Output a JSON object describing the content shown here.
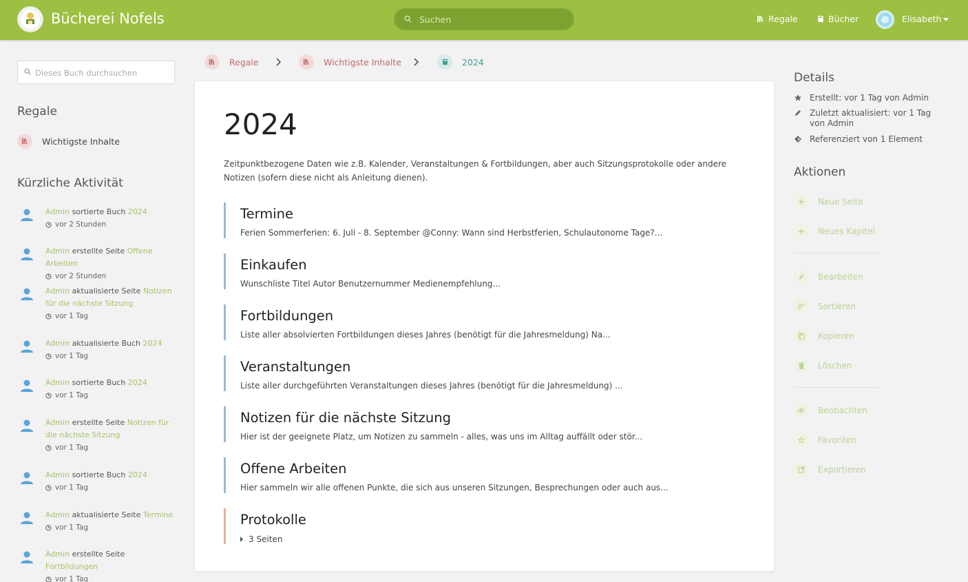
{
  "header": {
    "site_name": "Bücherei Nofels",
    "search_placeholder": "Suchen",
    "nav": [
      {
        "label": "Regale",
        "icon": "shelves-icon"
      },
      {
        "label": "Bücher",
        "icon": "book-icon"
      }
    ],
    "user": {
      "name": "Elisabeth"
    },
    "accent_color": "#9dbf42"
  },
  "left": {
    "book_search_placeholder": "Dieses Buch durchsuchen",
    "shelves_heading": "Regale",
    "shelf_item": "Wichtigste Inhalte",
    "activity_heading": "Kürzliche Aktivität",
    "activities": [
      {
        "user": "Admin",
        "action": "sortierte Buch",
        "target": "2024",
        "time": "vor 2 Stunden"
      },
      {
        "user": "Admin",
        "action": "erstellte Seite",
        "target": "Offene Arbeiten",
        "time": "vor 2 Stunden"
      },
      {
        "user": "Admin",
        "action": "aktualisierte Seite",
        "target": "Notizen für die nächste Sitzung",
        "time": "vor 1 Tag"
      },
      {
        "user": "Admin",
        "action": "aktualisierte Buch",
        "target": "2024",
        "time": "vor 1 Tag"
      },
      {
        "user": "Admin",
        "action": "sortierte Buch",
        "target": "2024",
        "time": "vor 1 Tag"
      },
      {
        "user": "Admin",
        "action": "erstellte Seite",
        "target": "Notizen für die nächste Sitzung",
        "time": "vor 1 Tag"
      },
      {
        "user": "Admin",
        "action": "sortierte Buch",
        "target": "2024",
        "time": "vor 1 Tag"
      },
      {
        "user": "Admin",
        "action": "aktualisierte Seite",
        "target": "Termine",
        "time": "vor 1 Tag"
      },
      {
        "user": "Admin",
        "action": "erstellte Seite",
        "target": "Fortbildungen",
        "time": "vor 1 Tag"
      }
    ]
  },
  "breadcrumb": [
    {
      "label": "Regale",
      "color": "#c06a6a"
    },
    {
      "label": "Wichtigste Inhalte",
      "color": "#c06a6a"
    },
    {
      "label": "2024",
      "color": "#3f9b94"
    }
  ],
  "book": {
    "title": "2024",
    "description": "Zeitpunktbezogene Daten wie z.B. Kalender, Veranstaltungen & Fortbildungen, aber auch Sitzungsprotokolle oder andere Notizen (sofern diese nicht als Anleitung dienen).",
    "entries": [
      {
        "title": "Termine",
        "excerpt": "Ferien Sommerferien: 6. Juli - 8. September @Conny: Wann sind Herbstferien, Schulautonome Tage?..."
      },
      {
        "title": "Einkaufen",
        "excerpt": "Wunschliste Titel Autor Benutzernummer Medienempfehlung..."
      },
      {
        "title": "Fortbildungen",
        "excerpt": "Liste aller absolvierten Fortbildungen dieses Jahres (benötigt für die Jahresmeldung) Na..."
      },
      {
        "title": "Veranstaltungen",
        "excerpt": "Liste aller durchgeführten Veranstaltungen dieses Jahres (benötigt für die Jahresmeldung) ..."
      },
      {
        "title": "Notizen für die nächste Sitzung",
        "excerpt": "Hier ist der geeignete Platz, um Notizen zu sammeln - alles, was uns im Alltag auffällt oder stör..."
      },
      {
        "title": "Offene Arbeiten",
        "excerpt": "Hier sammeln wir alle offenen Punkte, die sich aus unseren Sitzungen, Besprechungen oder auch aus..."
      }
    ],
    "chapter": {
      "title": "Protokolle",
      "pages_label": "3 Seiten"
    }
  },
  "right": {
    "details_heading": "Details",
    "details": [
      {
        "icon": "star-icon",
        "text": "Erstellt: vor 1 Tag von Admin"
      },
      {
        "icon": "pencil-icon",
        "text": "Zuletzt aktualisiert: vor 1 Tag von Admin"
      },
      {
        "icon": "reference-icon",
        "text": "Referenziert von 1 Element"
      }
    ],
    "actions_heading": "Aktionen",
    "actions": [
      {
        "label": "Neue Seite",
        "icon": "plus-icon"
      },
      {
        "label": "Neues Kapitel",
        "icon": "plus-icon"
      },
      {
        "label": "Bearbeiten",
        "icon": "pencil-icon"
      },
      {
        "label": "Sortieren",
        "icon": "sort-icon"
      },
      {
        "label": "Kopieren",
        "icon": "copy-icon"
      },
      {
        "label": "Löschen",
        "icon": "trash-icon"
      },
      {
        "label": "Beobachten",
        "icon": "eye-icon"
      },
      {
        "label": "Favoriten",
        "icon": "star-outline-icon"
      },
      {
        "label": "Exportieren",
        "icon": "export-icon"
      }
    ]
  }
}
